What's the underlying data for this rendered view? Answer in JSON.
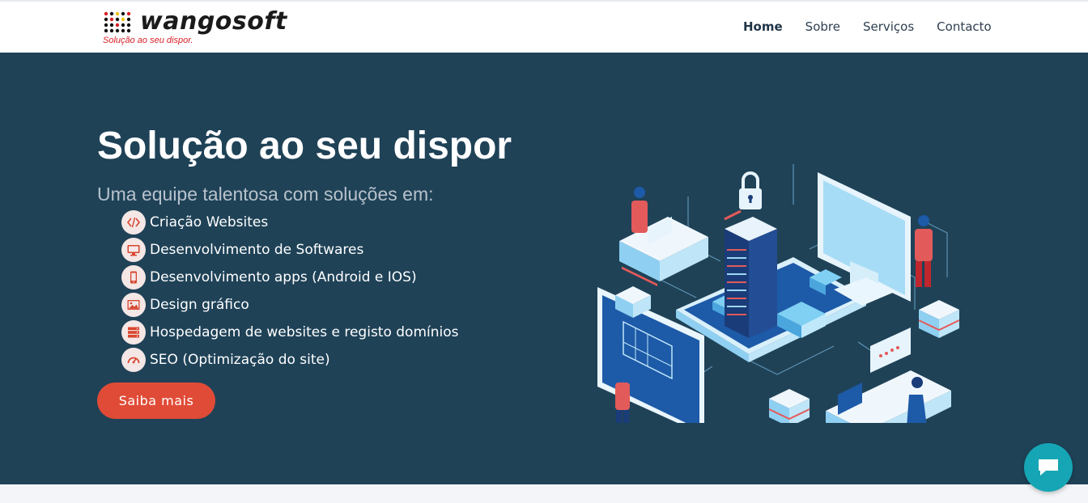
{
  "brand": {
    "name": "wangosoft",
    "tagline": "Solução ao seu dispor."
  },
  "nav": {
    "items": [
      {
        "label": "Home",
        "active": true
      },
      {
        "label": "Sobre",
        "active": false
      },
      {
        "label": "Serviços",
        "active": false
      },
      {
        "label": "Contacto",
        "active": false
      }
    ]
  },
  "hero": {
    "title": "Solução ao seu dispor",
    "subtitle": "Uma equipe talentosa com soluções em:",
    "services": [
      {
        "icon": "code-icon",
        "label": "Criação Websites"
      },
      {
        "icon": "monitor-icon",
        "label": "Desenvolvimento de Softwares"
      },
      {
        "icon": "mobile-icon",
        "label": "Desenvolvimento apps (Android e IOS)"
      },
      {
        "icon": "image-icon",
        "label": "Design gráfico"
      },
      {
        "icon": "server-icon",
        "label": "Hospedagem de websites e registo domínios"
      },
      {
        "icon": "speedometer-icon",
        "label": "SEO (Optimização do site)"
      }
    ],
    "cta_label": "Saiba mais"
  },
  "chat": {
    "icon": "chat-icon"
  },
  "colors": {
    "hero_bg": "#1f4257",
    "accent": "#e04b37",
    "chat": "#16a5b4"
  }
}
